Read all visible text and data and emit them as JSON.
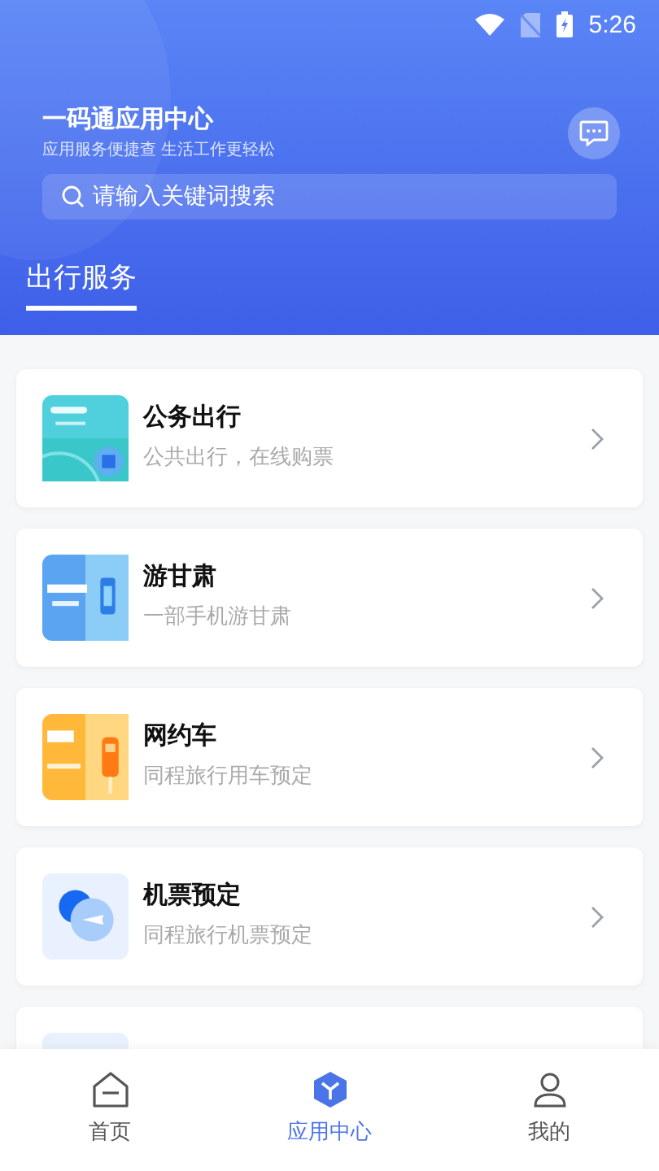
{
  "status_bar": {
    "time": "5:26"
  },
  "header": {
    "title": "一码通应用中心",
    "subtitle": "应用服务便捷查  生活工作更轻松",
    "search": {
      "placeholder": "请输入关键词搜索"
    }
  },
  "tabs": [
    {
      "label": "出行服务",
      "selected": true
    }
  ],
  "apps": [
    {
      "kind": "official",
      "title": "公务出行",
      "subtitle": "公共出行，在线购票"
    },
    {
      "kind": "tour",
      "title": "游甘肃",
      "subtitle": "一部手机游甘肃"
    },
    {
      "kind": "taxi",
      "title": "网约车",
      "subtitle": "同程旅行用车预定"
    },
    {
      "kind": "flight",
      "title": "机票预定",
      "subtitle": "同程旅行机票预定"
    },
    {
      "kind": "train"
    }
  ],
  "bottom_nav": [
    {
      "kind": "home",
      "label": "首页",
      "selected": false
    },
    {
      "kind": "apps",
      "label": "应用中心",
      "selected": true
    },
    {
      "kind": "me",
      "label": "我的",
      "selected": false
    }
  ]
}
